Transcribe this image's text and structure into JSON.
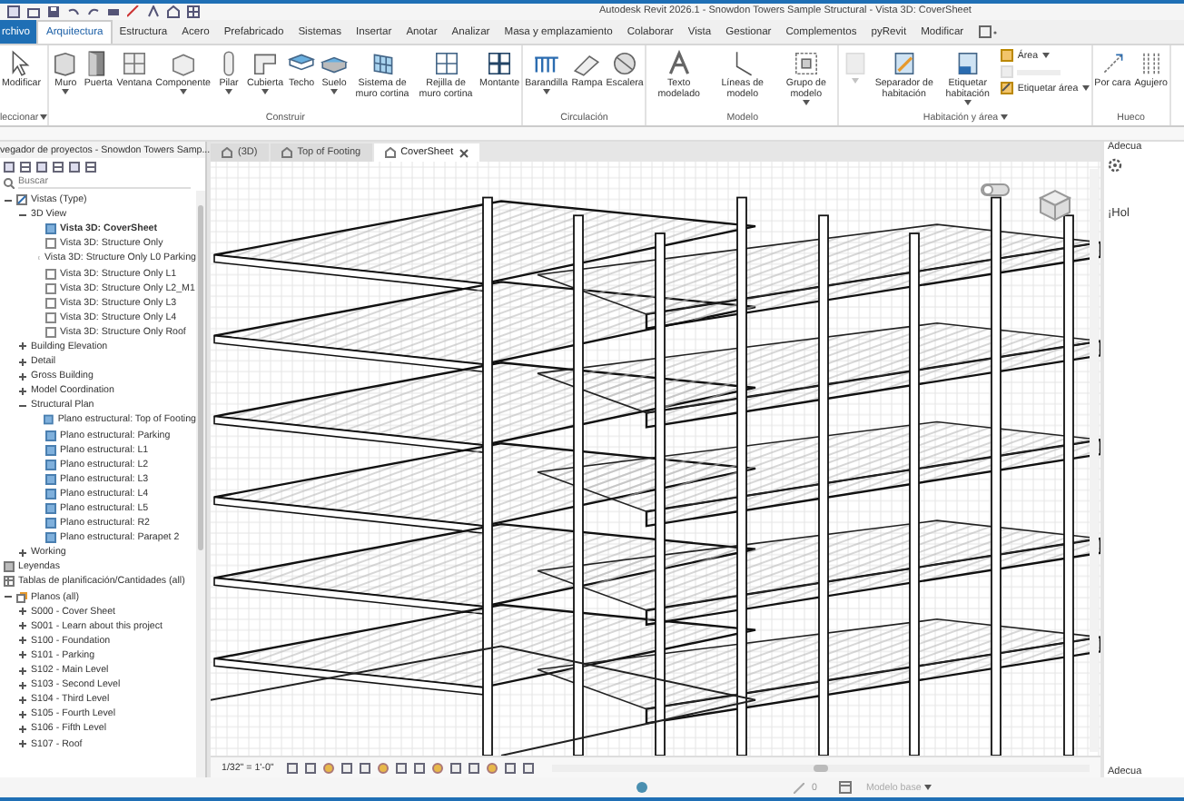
{
  "window": {
    "title": "Autodesk Revit 2026.1 - Snowdon Towers Sample Structural - Vista 3D: CoverSheet"
  },
  "ribbon_tabs": [
    {
      "label": "rchivo",
      "kind": "file",
      "selected": false
    },
    {
      "label": "Arquitectura",
      "kind": "tab",
      "selected": true
    },
    {
      "label": "Estructura",
      "kind": "tab",
      "selected": false
    },
    {
      "label": "Acero",
      "kind": "tab",
      "selected": false
    },
    {
      "label": "Prefabricado",
      "kind": "tab",
      "selected": false
    },
    {
      "label": "Sistemas",
      "kind": "tab",
      "selected": false
    },
    {
      "label": "Insertar",
      "kind": "tab",
      "selected": false
    },
    {
      "label": "Anotar",
      "kind": "tab",
      "selected": false
    },
    {
      "label": "Analizar",
      "kind": "tab",
      "selected": false
    },
    {
      "label": "Masa y emplazamiento",
      "kind": "tab",
      "selected": false
    },
    {
      "label": "Colaborar",
      "kind": "tab",
      "selected": false
    },
    {
      "label": "Vista",
      "kind": "tab",
      "selected": false
    },
    {
      "label": "Gestionar",
      "kind": "tab",
      "selected": false
    },
    {
      "label": "Complementos",
      "kind": "tab",
      "selected": false
    },
    {
      "label": "pyRevit",
      "kind": "tab",
      "selected": false
    },
    {
      "label": "Modificar",
      "kind": "tab",
      "selected": false
    }
  ],
  "ribbon": {
    "panels": [
      {
        "title": "leccionar",
        "dropdown": true,
        "tools": [
          {
            "label": "Modificar",
            "kind": "large",
            "dropdown": false,
            "disabled": false
          }
        ]
      },
      {
        "title": "Construir",
        "dropdown": false,
        "tools": [
          {
            "label": "Muro",
            "kind": "large",
            "dropdown": true,
            "disabled": false
          },
          {
            "label": "Puerta",
            "kind": "large",
            "dropdown": false,
            "disabled": false
          },
          {
            "label": "Ventana",
            "kind": "large",
            "dropdown": false,
            "disabled": false
          },
          {
            "label": "Componente",
            "kind": "large",
            "dropdown": true,
            "disabled": false
          },
          {
            "label": "Pilar",
            "kind": "large",
            "dropdown": true,
            "disabled": false
          },
          {
            "label": "Cubierta",
            "kind": "large",
            "dropdown": true,
            "disabled": false
          },
          {
            "label": "Techo",
            "kind": "large",
            "dropdown": false,
            "disabled": false
          },
          {
            "label": "Suelo",
            "kind": "large",
            "dropdown": true,
            "disabled": false
          },
          {
            "label": "Sistema de muro cortina",
            "kind": "large",
            "dropdown": false,
            "disabled": false
          },
          {
            "label": "Rejilla de muro cortina",
            "kind": "large",
            "dropdown": false,
            "disabled": false
          },
          {
            "label": "Montante",
            "kind": "large",
            "dropdown": false,
            "disabled": false
          }
        ]
      },
      {
        "title": "Circulación",
        "dropdown": false,
        "tools": [
          {
            "label": "Barandilla",
            "kind": "large",
            "dropdown": true,
            "disabled": false
          },
          {
            "label": "Rampa",
            "kind": "large",
            "dropdown": false,
            "disabled": false
          },
          {
            "label": "Escalera",
            "kind": "large",
            "dropdown": false,
            "disabled": false
          }
        ]
      },
      {
        "title": "Modelo",
        "dropdown": false,
        "tools": [
          {
            "label": "Texto modelado",
            "kind": "large",
            "dropdown": false,
            "disabled": false
          },
          {
            "label": "Líneas de modelo",
            "kind": "large",
            "dropdown": false,
            "disabled": false
          },
          {
            "label": "Grupo de modelo",
            "kind": "large",
            "dropdown": true,
            "disabled": false
          }
        ]
      },
      {
        "title": "Habitación y área",
        "dropdown": true,
        "tools": [
          {
            "kind": "large",
            "dropdown": true,
            "disabled": true
          },
          {
            "label": "Separador de habitación",
            "kind": "large",
            "dropdown": false,
            "disabled": false
          },
          {
            "label": "Etiquetar habitación",
            "kind": "large",
            "dropdown": true,
            "disabled": false
          },
          {
            "label": "Área",
            "kind": "small",
            "dropdown": true,
            "disabled": false
          },
          {
            "kind": "small",
            "dropdown": false,
            "disabled": true
          },
          {
            "label": "Etiquetar área",
            "kind": "small",
            "dropdown": true,
            "disabled": false
          }
        ]
      },
      {
        "title": "Hueco",
        "dropdown": false,
        "tools": [
          {
            "label": "Por cara",
            "kind": "large",
            "dropdown": false,
            "disabled": false
          },
          {
            "label": "Agujero",
            "kind": "large",
            "dropdown": false,
            "disabled": false
          }
        ]
      }
    ]
  },
  "browser": {
    "title": "vegador de proyectos - Snowdon Towers Samp...",
    "search": {
      "placeholder": "Buscar"
    },
    "tree": [
      {
        "label": "Vistas (Type)",
        "kind": "views",
        "expanded": true,
        "children": [
          {
            "label": "3D View",
            "kind": "group",
            "expanded": true,
            "children": [
              {
                "label": "Vista 3D: CoverSheet",
                "kind": "view",
                "open": true,
                "selected": true
              },
              {
                "label": "Vista 3D: Structure Only",
                "kind": "view",
                "open": false,
                "selected": false
              },
              {
                "label": "Vista 3D: Structure Only L0 Parking",
                "kind": "view",
                "open": false,
                "selected": false
              },
              {
                "label": "Vista 3D: Structure Only L1",
                "kind": "view",
                "open": false,
                "selected": false
              },
              {
                "label": "Vista 3D: Structure Only L2_M1",
                "kind": "view",
                "open": false,
                "selected": false
              },
              {
                "label": "Vista 3D: Structure Only L3",
                "kind": "view",
                "open": false,
                "selected": false
              },
              {
                "label": "Vista 3D: Structure Only L4",
                "kind": "view",
                "open": false,
                "selected": false
              },
              {
                "label": "Vista 3D: Structure Only Roof",
                "kind": "view",
                "open": false,
                "selected": false
              }
            ]
          },
          {
            "label": "Building Elevation",
            "kind": "group",
            "expanded": false
          },
          {
            "label": "Detail",
            "kind": "group",
            "expanded": false
          },
          {
            "label": "Gross Building",
            "kind": "group",
            "expanded": false
          },
          {
            "label": "Model Coordination",
            "kind": "group",
            "expanded": false
          },
          {
            "label": "Structural Plan",
            "kind": "group",
            "expanded": true,
            "children": [
              {
                "label": "Plano estructural: Top of Footing",
                "kind": "view",
                "open": true,
                "selected": false
              },
              {
                "label": "Plano estructural: Parking",
                "kind": "view",
                "open": true,
                "selected": false
              },
              {
                "label": "Plano estructural: L1",
                "kind": "view",
                "open": true,
                "selected": false
              },
              {
                "label": "Plano estructural: L2",
                "kind": "view",
                "open": true,
                "selected": false
              },
              {
                "label": "Plano estructural: L3",
                "kind": "view",
                "open": true,
                "selected": false
              },
              {
                "label": "Plano estructural: L4",
                "kind": "view",
                "open": true,
                "selected": false
              },
              {
                "label": "Plano estructural: L5",
                "kind": "view",
                "open": true,
                "selected": false
              },
              {
                "label": "Plano estructural: R2",
                "kind": "view",
                "open": true,
                "selected": false
              },
              {
                "label": "Plano estructural: Parapet 2",
                "kind": "view",
                "open": true,
                "selected": false
              }
            ]
          },
          {
            "label": "Working",
            "kind": "group",
            "expanded": false
          }
        ]
      },
      {
        "label": "Leyendas",
        "kind": "legends"
      },
      {
        "label": "Tablas de planificación/Cantidades (all)",
        "kind": "schedules"
      },
      {
        "label": "Planos (all)",
        "kind": "sheets",
        "expanded": true,
        "children": [
          {
            "label": "S000 - Cover Sheet",
            "kind": "group",
            "expanded": false
          },
          {
            "label": "S001 - Learn about this project",
            "kind": "group",
            "expanded": false
          },
          {
            "label": "S100 - Foundation",
            "kind": "group",
            "expanded": false
          },
          {
            "label": "S101 - Parking",
            "kind": "group",
            "expanded": false
          },
          {
            "label": "S102 - Main Level",
            "kind": "group",
            "expanded": false
          },
          {
            "label": "S103 - Second Level",
            "kind": "group",
            "expanded": false
          },
          {
            "label": "S104 - Third Level",
            "kind": "group",
            "expanded": false
          },
          {
            "label": "S105 - Fourth Level",
            "kind": "group",
            "expanded": false
          },
          {
            "label": "S106 - Fifth Level",
            "kind": "group",
            "expanded": false
          },
          {
            "label": "S107 - Roof",
            "kind": "group",
            "expanded": false
          }
        ]
      }
    ]
  },
  "view_tabs": [
    {
      "label": "(3D)",
      "selected": false
    },
    {
      "label": "Top of Footing",
      "selected": false
    },
    {
      "label": "CoverSheet",
      "selected": true
    }
  ],
  "view_control_bar": {
    "scale": "1/32\" = 1'-0\""
  },
  "properties": {
    "header": "Adecua",
    "greeting": "¡Hol",
    "footer": "Adecua"
  },
  "status_bar": {
    "count": "0",
    "model": "Modelo base"
  }
}
